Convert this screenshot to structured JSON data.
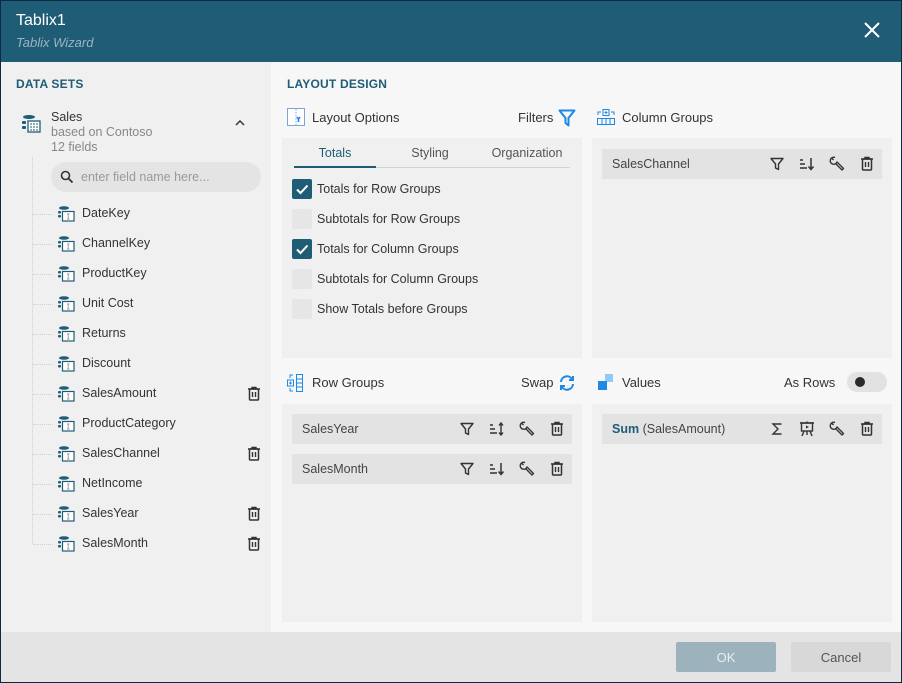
{
  "header": {
    "title": "Tablix1",
    "subtitle": "Tablix Wizard"
  },
  "sidebar": {
    "section_title": "DATA SETS",
    "dataset": {
      "name": "Sales",
      "based_on": "based on Contoso",
      "field_count": "12 fields"
    },
    "search": {
      "placeholder": "enter field name here...",
      "value": ""
    },
    "fields": [
      {
        "name": "DateKey",
        "used": false
      },
      {
        "name": "ChannelKey",
        "used": false
      },
      {
        "name": "ProductKey",
        "used": false
      },
      {
        "name": "Unit Cost",
        "used": false
      },
      {
        "name": "Returns",
        "used": false
      },
      {
        "name": "Discount",
        "used": false
      },
      {
        "name": "SalesAmount",
        "used": true
      },
      {
        "name": "ProductCategory",
        "used": false
      },
      {
        "name": "SalesChannel",
        "used": true
      },
      {
        "name": "NetIncome",
        "used": false
      },
      {
        "name": "SalesYear",
        "used": true
      },
      {
        "name": "SalesMonth",
        "used": true
      }
    ]
  },
  "main": {
    "section_title": "LAYOUT DESIGN",
    "layout_options": {
      "label": "Layout Options",
      "filters_label": "Filters",
      "tabs": [
        {
          "label": "Totals",
          "active": true
        },
        {
          "label": "Styling",
          "active": false
        },
        {
          "label": "Organization",
          "active": false
        }
      ],
      "checkboxes": [
        {
          "label": "Totals for Row Groups",
          "checked": true
        },
        {
          "label": "Subtotals for Row Groups",
          "checked": false
        },
        {
          "label": "Totals for Column Groups",
          "checked": true
        },
        {
          "label": "Subtotals for Column Groups",
          "checked": false
        },
        {
          "label": "Show Totals before Groups",
          "checked": false
        }
      ]
    },
    "column_groups": {
      "label": "Column Groups",
      "items": [
        {
          "name": "SalesChannel",
          "sort": "descending"
        }
      ]
    },
    "row_groups": {
      "label": "Row Groups",
      "swap_label": "Swap",
      "items": [
        {
          "name": "SalesYear",
          "sort": "none"
        },
        {
          "name": "SalesMonth",
          "sort": "descending"
        }
      ]
    },
    "values": {
      "label": "Values",
      "as_rows_label": "As Rows",
      "as_rows": false,
      "items": [
        {
          "aggregate": "Sum",
          "field": "(SalesAmount)"
        }
      ]
    }
  },
  "footer": {
    "ok_label": "OK",
    "cancel_label": "Cancel"
  },
  "colors": {
    "accent": "#1f5c76",
    "icon_blue": "#1e88e5",
    "header_bg": "#1f5c76"
  }
}
